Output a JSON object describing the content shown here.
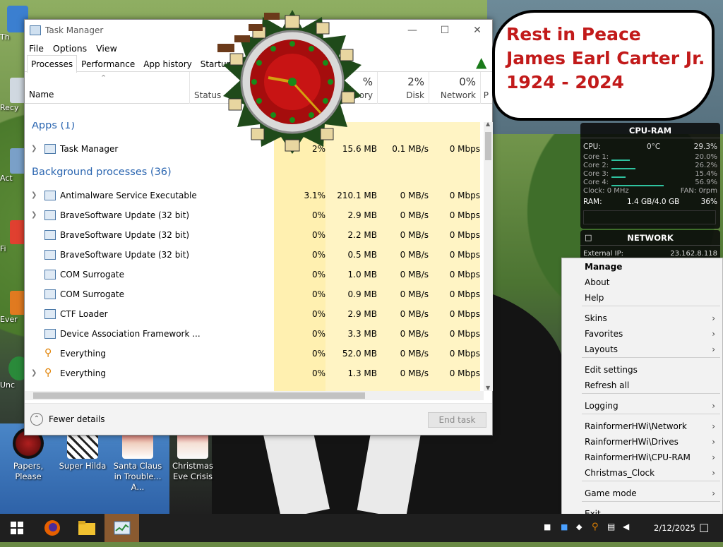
{
  "desktop": {
    "icons": [
      {
        "label": "Papers, Please",
        "icon": "papers-please-icon"
      },
      {
        "label": "Super Hilda",
        "icon": "super-hilda-icon"
      },
      {
        "label": "Santa Claus in Trouble... A...",
        "icon": "santa-claus-icon"
      },
      {
        "label": "Christmas Eve Crisis",
        "icon": "christmas-eve-icon"
      }
    ],
    "edge_labels": [
      "Th",
      "Recy",
      "Act",
      "Fi",
      "Ever",
      "Unc"
    ]
  },
  "task_manager": {
    "title": "Task Manager",
    "menu": [
      "File",
      "Options",
      "View"
    ],
    "tabs": [
      "Processes",
      "Performance",
      "App history",
      "Startup"
    ],
    "active_tab": "Processes",
    "columns": {
      "name": "Name",
      "status": "Status",
      "memory_pct": "%",
      "memory": "nory",
      "disk_pct": "2%",
      "disk": "Disk",
      "network_pct": "0%",
      "network": "Network",
      "extra": "P"
    },
    "groups": [
      {
        "label": "Apps (1)"
      },
      {
        "label": "Background processes (36)"
      }
    ],
    "apps": [
      {
        "name": "Task Manager",
        "cpu": "2%",
        "memory": "15.6 MB",
        "disk": "0.1 MB/s",
        "network": "0 Mbps",
        "expandable": true,
        "icon": "task-manager-icon"
      }
    ],
    "background": [
      {
        "name": "Antimalware Service Executable",
        "cpu": "3.1%",
        "memory": "210.1 MB",
        "disk": "0 MB/s",
        "network": "0 Mbps",
        "expandable": true,
        "icon": "service-icon"
      },
      {
        "name": "BraveSoftware Update (32 bit)",
        "cpu": "0%",
        "memory": "2.9 MB",
        "disk": "0 MB/s",
        "network": "0 Mbps",
        "expandable": true,
        "icon": "update-icon"
      },
      {
        "name": "BraveSoftware Update (32 bit)",
        "cpu": "0%",
        "memory": "2.2 MB",
        "disk": "0 MB/s",
        "network": "0 Mbps",
        "expandable": false,
        "icon": "update-icon"
      },
      {
        "name": "BraveSoftware Update (32 bit)",
        "cpu": "0%",
        "memory": "0.5 MB",
        "disk": "0 MB/s",
        "network": "0 Mbps",
        "expandable": false,
        "icon": "update-icon"
      },
      {
        "name": "COM Surrogate",
        "cpu": "0%",
        "memory": "1.0 MB",
        "disk": "0 MB/s",
        "network": "0 Mbps",
        "expandable": false,
        "icon": "service-icon"
      },
      {
        "name": "COM Surrogate",
        "cpu": "0%",
        "memory": "0.9 MB",
        "disk": "0 MB/s",
        "network": "0 Mbps",
        "expandable": false,
        "icon": "service-icon"
      },
      {
        "name": "CTF Loader",
        "cpu": "0%",
        "memory": "2.9 MB",
        "disk": "0 MB/s",
        "network": "0 Mbps",
        "expandable": false,
        "icon": "ctf-icon"
      },
      {
        "name": "Device Association Framework ...",
        "cpu": "0%",
        "memory": "3.3 MB",
        "disk": "0 MB/s",
        "network": "0 Mbps",
        "expandable": false,
        "icon": "service-icon"
      },
      {
        "name": "Everything",
        "cpu": "0%",
        "memory": "52.0 MB",
        "disk": "0 MB/s",
        "network": "0 Mbps",
        "expandable": false,
        "icon": "search-icon"
      },
      {
        "name": "Everything",
        "cpu": "0%",
        "memory": "1.3 MB",
        "disk": "0 MB/s",
        "network": "0 Mbps",
        "expandable": true,
        "icon": "search-icon"
      }
    ],
    "footer": {
      "fewer_details": "Fewer details",
      "end_task": "End task"
    }
  },
  "bubble": {
    "lines": [
      "Rest in Peace",
      "James Earl Carter Jr.",
      "1924 - 2024"
    ],
    "color": "#c21a1a"
  },
  "cpu_ram": {
    "title": "CPU-RAM",
    "cpu_label": "CPU:",
    "temp": "0°C",
    "cpu_total": "29.3%",
    "cores": [
      {
        "label": "Core 1:",
        "value": "20.0%",
        "pct": 20.0
      },
      {
        "label": "Core 2:",
        "value": "26.2%",
        "pct": 26.2
      },
      {
        "label": "Core 3:",
        "value": "15.4%",
        "pct": 15.4
      },
      {
        "label": "Core 4:",
        "value": "56.9%",
        "pct": 56.9
      }
    ],
    "clock": "Clock: 0 MHz",
    "fan": "FAN: 0rpm",
    "ram_label": "RAM:",
    "ram_used": "1.4 GB/4.0 GB",
    "ram_pct": "36%"
  },
  "network": {
    "title": "NETWORK",
    "ext_ip_label": "External IP:",
    "ext_ip": "23.162.8.118"
  },
  "context_menu": {
    "items": [
      {
        "label": "Manage",
        "bold": true,
        "submenu": false
      },
      {
        "label": "About",
        "bold": false,
        "submenu": false
      },
      {
        "label": "Help",
        "bold": false,
        "submenu": false
      },
      {
        "label": "Skins",
        "bold": false,
        "submenu": true
      },
      {
        "label": "Favorites",
        "bold": false,
        "submenu": true
      },
      {
        "label": "Layouts",
        "bold": false,
        "submenu": true
      },
      {
        "label": "Edit settings",
        "bold": false,
        "submenu": false
      },
      {
        "label": "Refresh all",
        "bold": false,
        "submenu": false
      },
      {
        "label": "Logging",
        "bold": false,
        "submenu": true
      },
      {
        "label": "RainformerHWi\\Network",
        "bold": false,
        "submenu": true
      },
      {
        "label": "RainformerHWi\\Drives",
        "bold": false,
        "submenu": true
      },
      {
        "label": "RainformerHWi\\CPU-RAM",
        "bold": false,
        "submenu": true
      },
      {
        "label": "Christmas_Clock",
        "bold": false,
        "submenu": true
      },
      {
        "label": "Game mode",
        "bold": false,
        "submenu": true
      },
      {
        "label": "Exit",
        "bold": false,
        "submenu": false
      }
    ]
  },
  "taskbar": {
    "apps": [
      "start-icon",
      "firefox-icon",
      "file-explorer-icon",
      "task-manager-icon"
    ],
    "date": "2/12/2025"
  }
}
